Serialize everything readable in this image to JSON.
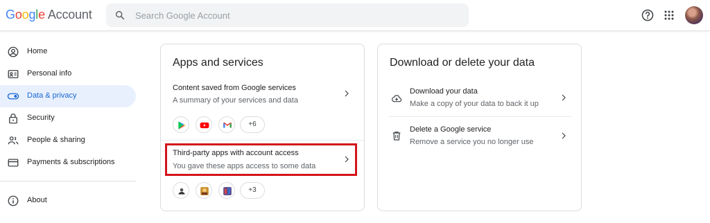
{
  "header": {
    "logo_google": [
      "G",
      "o",
      "o",
      "g",
      "l",
      "e"
    ],
    "logo_account": "Account",
    "search_placeholder": "Search Google Account"
  },
  "sidebar": {
    "items": [
      {
        "label": "Home",
        "icon": "home-person-icon"
      },
      {
        "label": "Personal info",
        "icon": "id-card-icon"
      },
      {
        "label": "Data & privacy",
        "icon": "toggle-icon",
        "active": true
      },
      {
        "label": "Security",
        "icon": "lock-icon"
      },
      {
        "label": "People & sharing",
        "icon": "people-icon"
      },
      {
        "label": "Payments & subscriptions",
        "icon": "credit-card-icon"
      }
    ],
    "about": {
      "label": "About",
      "icon": "info-icon"
    }
  },
  "apps_card": {
    "title": "Apps and services",
    "rows": [
      {
        "title": "Content saved from Google services",
        "subtitle": "A summary of your services and data",
        "chips": [
          "google-play-icon",
          "youtube-icon",
          "gmail-icon"
        ],
        "more": "+6"
      },
      {
        "title": "Third-party apps with account access",
        "subtitle": "You gave these apps access to some data",
        "chips": [
          "app-icon-1",
          "app-icon-2",
          "app-icon-3"
        ],
        "more": "+3"
      }
    ]
  },
  "data_card": {
    "title": "Download or delete your data",
    "rows": [
      {
        "title": "Download your data",
        "subtitle": "Make a copy of your data to back it up",
        "icon": "cloud-download-icon"
      },
      {
        "title": "Delete a Google service",
        "subtitle": "Remove a service you no longer use",
        "icon": "trash-icon"
      }
    ]
  },
  "colors": {
    "accent": "#1967d2",
    "active_bg": "#e8f0fe",
    "highlight": "#d3141a"
  }
}
